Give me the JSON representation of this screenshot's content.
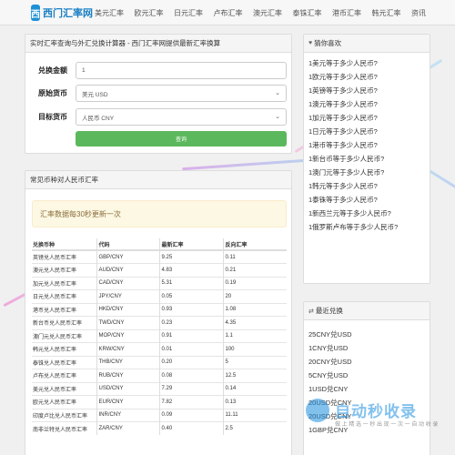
{
  "header": {
    "logo_char": "西",
    "logo_text": "西门汇率网",
    "nav": [
      "美元汇率",
      "欧元汇率",
      "日元汇率",
      "卢布汇率",
      "澳元汇率",
      "泰铢汇率",
      "港币汇率",
      "韩元汇率",
      "资讯"
    ]
  },
  "calculator": {
    "title": "实时汇率查询与外汇兑换计算器 - 西门汇率网提供最新汇率换算",
    "amount_label": "兑换金额",
    "amount_value": "1",
    "source_label": "原始货币",
    "source_value": "美元 USD",
    "target_label": "目标货币",
    "target_value": "人民币 CNY",
    "query_button": "查询"
  },
  "rates": {
    "title": "常见币种对人民币汇率",
    "notice": "汇率数据每30秒更新一次",
    "columns": [
      "兑换币种",
      "代码",
      "最新汇率",
      "反向汇率"
    ],
    "rows": [
      [
        "英镑兑人民币汇率",
        "GBP/CNY",
        "9.25",
        "0.11"
      ],
      [
        "澳元兑人民币汇率",
        "AUD/CNY",
        "4.83",
        "0.21"
      ],
      [
        "加元兑人民币汇率",
        "CAD/CNY",
        "5.31",
        "0.19"
      ],
      [
        "日元兑人民币汇率",
        "JPY/CNY",
        "0.05",
        "20"
      ],
      [
        "港币兑人民币汇率",
        "HKD/CNY",
        "0.93",
        "1.08"
      ],
      [
        "新台币兑人民币汇率",
        "TWD/CNY",
        "0.23",
        "4.35"
      ],
      [
        "澳门元兑人民币汇率",
        "MOP/CNY",
        "0.91",
        "1.1"
      ],
      [
        "韩元兑人民币汇率",
        "KRW/CNY",
        "0.01",
        "100"
      ],
      [
        "泰铢兑人民币汇率",
        "THB/CNY",
        "0.20",
        "5"
      ],
      [
        "卢布兑人民币汇率",
        "RUB/CNY",
        "0.08",
        "12.5"
      ],
      [
        "美元兑人民币汇率",
        "USD/CNY",
        "7.29",
        "0.14"
      ],
      [
        "欧元兑人民币汇率",
        "EUR/CNY",
        "7.82",
        "0.13"
      ],
      [
        "印度卢比兑人民币汇率",
        "INR/CNY",
        "0.09",
        "11.11"
      ],
      [
        "南非兰特兑人民币汇率",
        "ZAR/CNY",
        "0.40",
        "2.5"
      ]
    ]
  },
  "guess": {
    "title": "猜你喜欢",
    "items": [
      "1美元等于多少人民币?",
      "1欧元等于多少人民币?",
      "1英镑等于多少人民币?",
      "1澳元等于多少人民币?",
      "1加元等于多少人民币?",
      "1日元等于多少人民币?",
      "1港币等于多少人民币?",
      "1新台币等于多少人民币?",
      "1澳门元等于多少人民币?",
      "1韩元等于多少人民币?",
      "1泰铢等于多少人民币?",
      "1新西兰元等于多少人民币?",
      "1俄罗斯卢布等于多少人民币?"
    ]
  },
  "recent": {
    "title": "最近兑换",
    "items": [
      "25CNY兑USD",
      "1CNY兑USD",
      "20CNY兑USD",
      "5CNY兑USD",
      "1USD兑CNY",
      "20USD兑CNY",
      "20USD兑CNY",
      "1GBP兑CNY"
    ]
  },
  "watermark": {
    "text": "自动秒收录",
    "subtitle": "做 上 精 选 一 秒 出 现 一 次 一 自 动 收 录"
  },
  "colors": {
    "accent": "#1e90d6",
    "button": "#5cb85c",
    "notice_bg": "#fcf8e3",
    "notice_text": "#8a6d3b"
  },
  "icons": {
    "guess_head": "heart-icon",
    "recent_head": "exchange-icon",
    "select_arrow": "chevron-down-icon"
  }
}
